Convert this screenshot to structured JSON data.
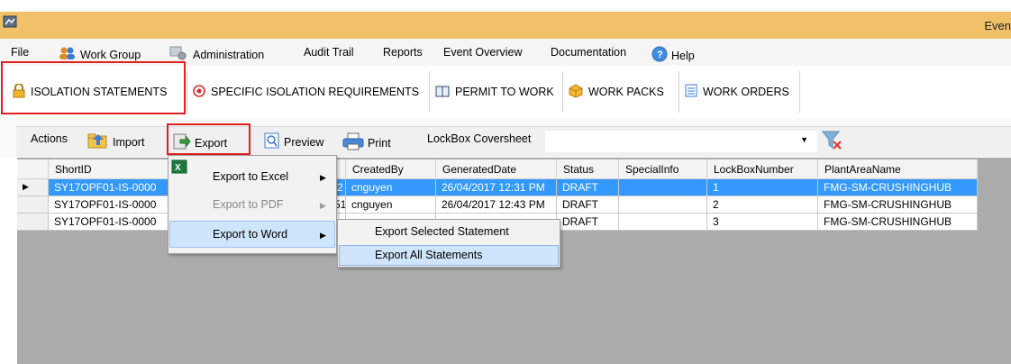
{
  "window": {
    "title": "Even"
  },
  "menu": {
    "file": "File",
    "work_group": "Work Group",
    "administration": "Administration",
    "audit_trail": "Audit Trail",
    "reports": "Reports",
    "event_overview": "Event Overview",
    "documentation": "Documentation",
    "help": "Help"
  },
  "tabs": [
    {
      "label": "ISOLATION STATEMENTS",
      "icon": "lock-icon"
    },
    {
      "label": "SPECIFIC ISOLATION REQUIREMENTS",
      "icon": "target-icon"
    },
    {
      "label": "PERMIT TO WORK",
      "icon": "book-icon"
    },
    {
      "label": "WORK PACKS",
      "icon": "box-icon"
    },
    {
      "label": "WORK ORDERS",
      "icon": "form-icon"
    }
  ],
  "toolbar": {
    "actions": "Actions",
    "import": "Import",
    "export": "Export",
    "preview": "Preview",
    "print": "Print",
    "lockbox_coversheet": "LockBox Coversheet",
    "combo_value": ""
  },
  "grid": {
    "columns": [
      "ShortID",
      "CreatedBy",
      "GeneratedDate",
      "Status",
      "SpecialInfo",
      "LockBoxNumber",
      "PlantAreaName"
    ],
    "rows": [
      {
        "short_id": "SY17OPF01-IS-0000",
        "hidden_tail": "2",
        "created_by": "cnguyen",
        "generated_date": "26/04/2017 12:31 PM",
        "status": "DRAFT",
        "special_info": "",
        "lockbox": "1",
        "plant_area": "FMG-SM-CRUSHINGHUB"
      },
      {
        "short_id": "SY17OPF01-IS-0000",
        "hidden_tail": "51",
        "created_by": "cnguyen",
        "generated_date": "26/04/2017 12:43 PM",
        "status": "DRAFT",
        "special_info": "",
        "lockbox": "2",
        "plant_area": "FMG-SM-CRUSHINGHUB"
      },
      {
        "short_id": "SY17OPF01-IS-0000",
        "hidden_tail": "",
        "created_by": "",
        "generated_date": "",
        "status": "DRAFT",
        "special_info": "",
        "lockbox": "3",
        "plant_area": "FMG-SM-CRUSHINGHUB"
      }
    ]
  },
  "export_menu": {
    "excel": "Export to Excel",
    "pdf": "Export to PDF",
    "word": "Export to Word"
  },
  "word_submenu": {
    "selected": "Export Selected Statement",
    "all": "Export All Statements"
  },
  "colors": {
    "titlebar": "#f1c16a",
    "highlight_red": "#e02020",
    "selection_blue": "#3399ff"
  }
}
